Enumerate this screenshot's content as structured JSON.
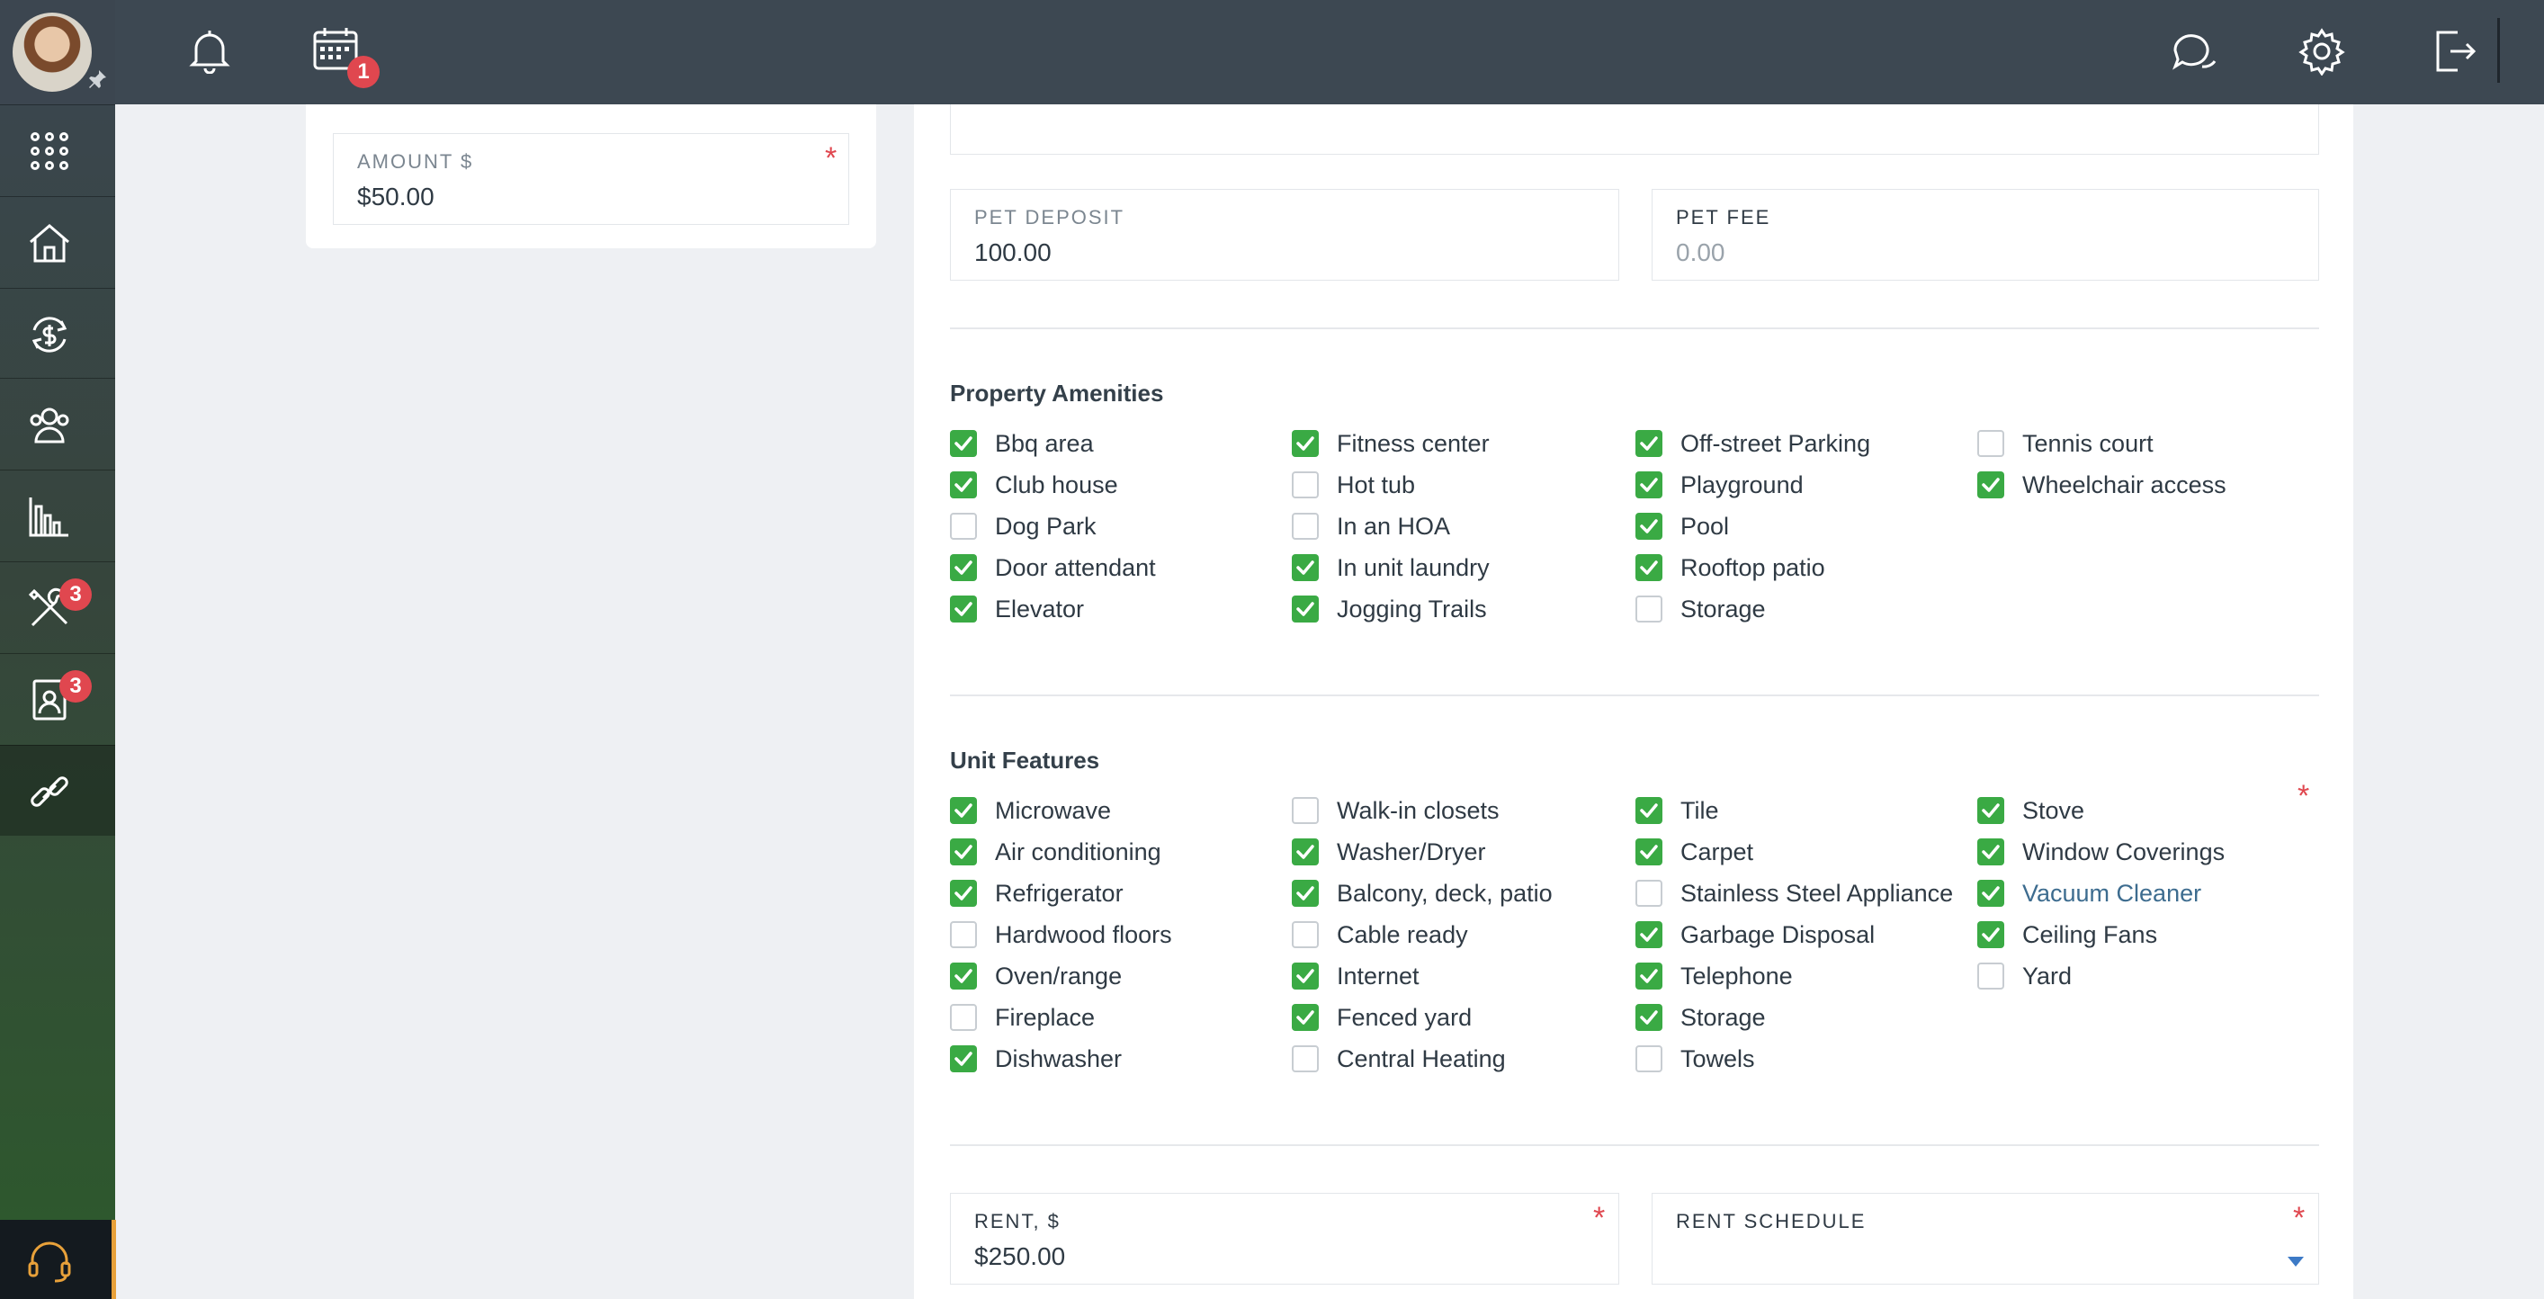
{
  "topbar": {
    "calendar_badge": "1"
  },
  "sidebar": {
    "maintenance_badge": "3",
    "tenants_badge": "3"
  },
  "left_card": {
    "amount_label": "AMOUNT $",
    "amount_value": "$50.00"
  },
  "pets": {
    "deposit_label": "PET DEPOSIT",
    "deposit_value": "100.00",
    "fee_label": "PET FEE",
    "fee_placeholder": "0.00"
  },
  "amenities": {
    "title": "Property Amenities",
    "items": [
      {
        "label": "Bbq area",
        "checked": true
      },
      {
        "label": "Club house",
        "checked": true
      },
      {
        "label": "Dog Park",
        "checked": false
      },
      {
        "label": "Door attendant",
        "checked": true
      },
      {
        "label": "Elevator",
        "checked": true
      },
      {
        "label": "Fitness center",
        "checked": true
      },
      {
        "label": "Hot tub",
        "checked": false
      },
      {
        "label": "In an HOA",
        "checked": false
      },
      {
        "label": "In unit laundry",
        "checked": true
      },
      {
        "label": "Jogging Trails",
        "checked": true
      },
      {
        "label": "Off-street Parking",
        "checked": true
      },
      {
        "label": "Playground",
        "checked": true
      },
      {
        "label": "Pool",
        "checked": true
      },
      {
        "label": "Rooftop patio",
        "checked": true
      },
      {
        "label": "Storage",
        "checked": false
      },
      {
        "label": "Tennis court",
        "checked": false
      },
      {
        "label": "Wheelchair access",
        "checked": true
      }
    ]
  },
  "features": {
    "title": "Unit Features",
    "items": [
      {
        "label": "Microwave",
        "checked": true
      },
      {
        "label": "Air conditioning",
        "checked": true
      },
      {
        "label": "Refrigerator",
        "checked": true
      },
      {
        "label": "Hardwood floors",
        "checked": false
      },
      {
        "label": "Oven/range",
        "checked": true
      },
      {
        "label": "Fireplace",
        "checked": false
      },
      {
        "label": "Dishwasher",
        "checked": true
      },
      {
        "label": "Walk-in closets",
        "checked": false
      },
      {
        "label": "Washer/Dryer",
        "checked": true
      },
      {
        "label": "Balcony, deck, patio",
        "checked": true
      },
      {
        "label": "Cable ready",
        "checked": false
      },
      {
        "label": "Internet",
        "checked": true
      },
      {
        "label": "Fenced yard",
        "checked": true
      },
      {
        "label": "Central Heating",
        "checked": false
      },
      {
        "label": "Tile",
        "checked": true
      },
      {
        "label": "Carpet",
        "checked": true
      },
      {
        "label": "Stainless Steel Appliance",
        "checked": false
      },
      {
        "label": "Garbage Disposal",
        "checked": true
      },
      {
        "label": "Telephone",
        "checked": true
      },
      {
        "label": "Storage",
        "checked": true
      },
      {
        "label": "Towels",
        "checked": false
      },
      {
        "label": "Stove",
        "checked": true
      },
      {
        "label": "Window Coverings",
        "checked": true
      },
      {
        "label": "Vacuum Cleaner",
        "checked": true
      },
      {
        "label": "Ceiling Fans",
        "checked": true
      },
      {
        "label": "Yard",
        "checked": false
      }
    ]
  },
  "rent": {
    "rent_label": "RENT, $",
    "rent_value": "$250.00",
    "schedule_label": "RENT SCHEDULE",
    "schedule_value": ""
  },
  "colors": {
    "accent_green": "#3aaa44",
    "badge_red": "#e0474f",
    "topbar": "#3d4852"
  }
}
